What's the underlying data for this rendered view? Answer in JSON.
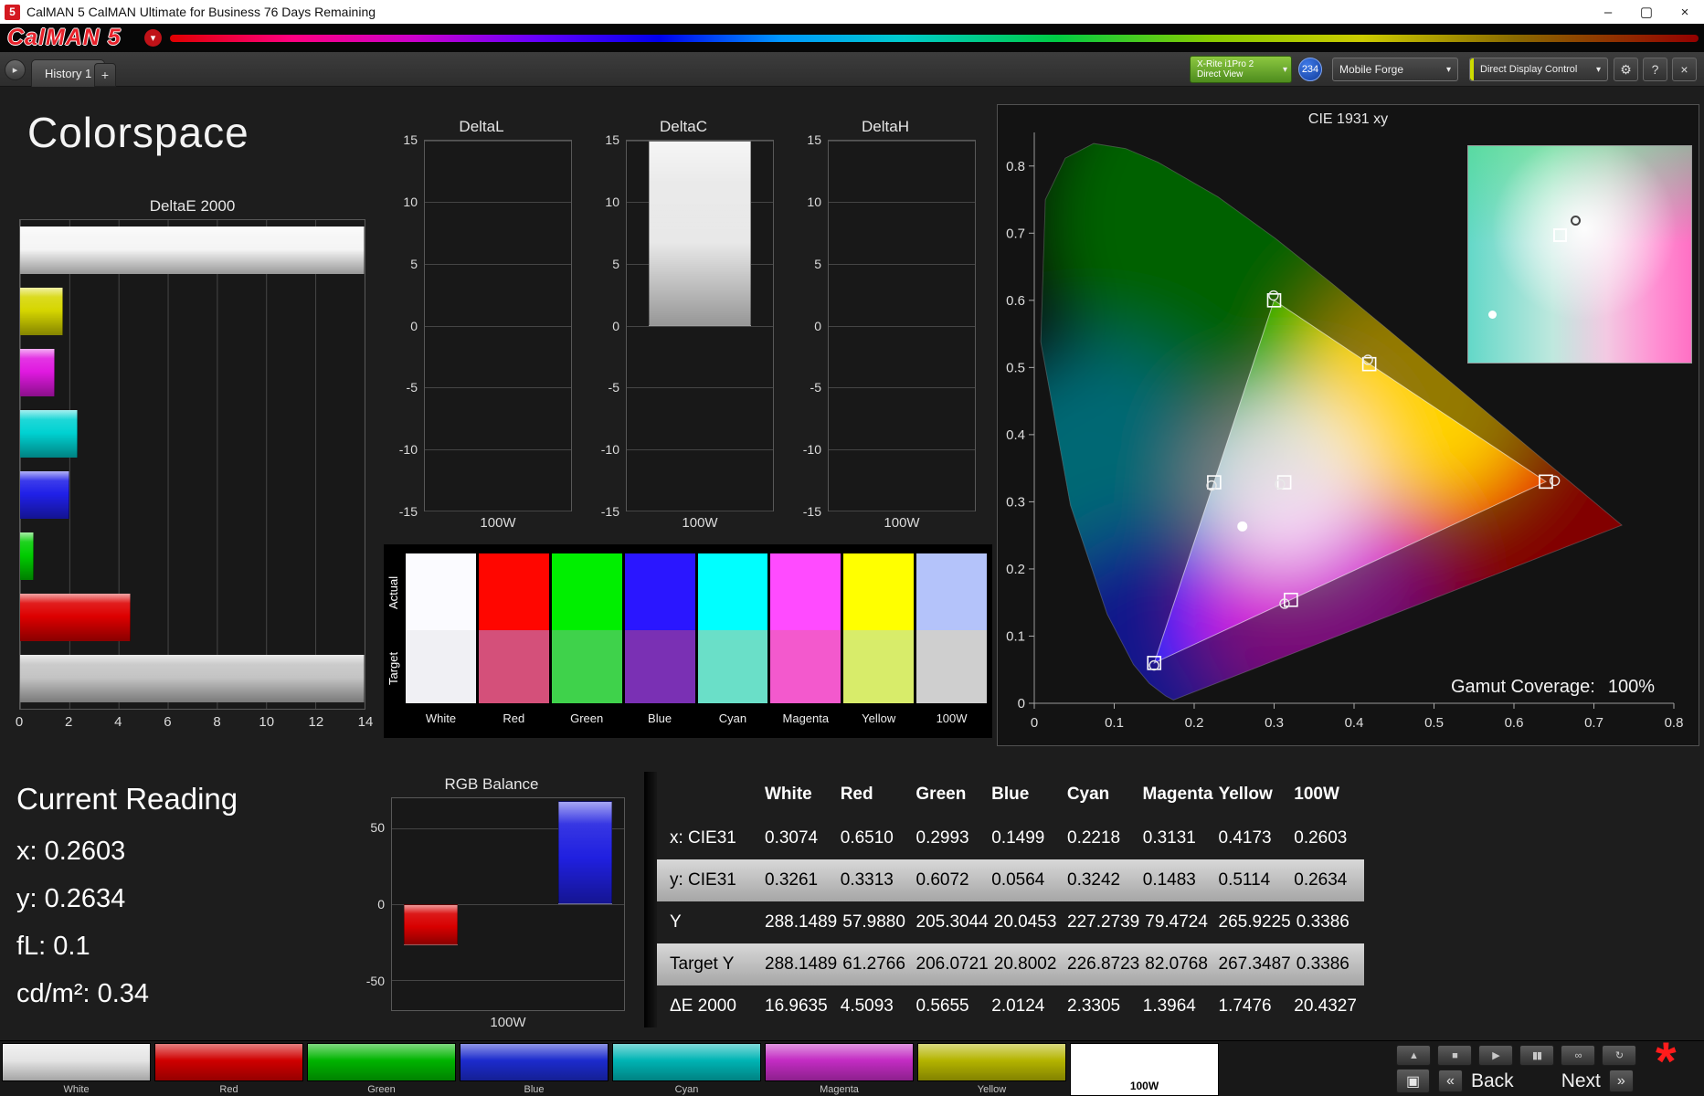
{
  "window": {
    "icon_text": "5",
    "title": "CalMAN 5 CalMAN Ultimate for Business 76 Days Remaining",
    "controls": {
      "minimize": "–",
      "maximize": "▢",
      "close": "×"
    }
  },
  "brand": {
    "logo": "CalMAN 5",
    "chevron": "▾"
  },
  "tabbar": {
    "nav_glyph": "▸",
    "tab_label": "History 1",
    "add_label": "+",
    "meter_line1": "X-Rite i1Pro 2",
    "meter_line2": "Direct View",
    "badge": "234",
    "source_label": "Mobile Forge",
    "control_label": "Direct Display Control",
    "chevron": "▾",
    "gear_glyph": "⚙",
    "help_glyph": "?",
    "close_glyph": "×"
  },
  "page": {
    "title": "Colorspace"
  },
  "current_reading": {
    "title": "Current Reading",
    "lines": [
      "x: 0.2603",
      "y: 0.2634",
      "fL: 0.1",
      "cd/m²: 0.34"
    ]
  },
  "swatches": {
    "row_labels": [
      "Actual",
      "Target"
    ],
    "columns": [
      {
        "label": "White",
        "actual": "#fbfbff",
        "target": "#f0f0f4"
      },
      {
        "label": "Red",
        "actual": "#ff0600",
        "target": "#d4507a"
      },
      {
        "label": "Green",
        "actual": "#00ef00",
        "target": "#3fd24b"
      },
      {
        "label": "Blue",
        "actual": "#2a16ff",
        "target": "#7a30b4"
      },
      {
        "label": "Cyan",
        "actual": "#00ffff",
        "target": "#6adfc8"
      },
      {
        "label": "Magenta",
        "actual": "#ff4bff",
        "target": "#f359cd"
      },
      {
        "label": "Yellow",
        "actual": "#ffff00",
        "target": "#d8ec6a"
      },
      {
        "label": "100W",
        "actual": "#b4c3fa",
        "target": "#cfcfcf"
      }
    ]
  },
  "table": {
    "columns": [
      "White",
      "Red",
      "Green",
      "Blue",
      "Cyan",
      "Magenta",
      "Yellow",
      "100W"
    ],
    "rows": [
      {
        "label": "x: CIE31",
        "striped": false,
        "values": [
          "0.3074",
          "0.6510",
          "0.2993",
          "0.1499",
          "0.2218",
          "0.3131",
          "0.4173",
          "0.2603"
        ]
      },
      {
        "label": "y: CIE31",
        "striped": true,
        "values": [
          "0.3261",
          "0.3313",
          "0.6072",
          "0.0564",
          "0.3242",
          "0.1483",
          "0.5114",
          "0.2634"
        ]
      },
      {
        "label": "Y",
        "striped": false,
        "values": [
          "288.1489",
          "57.9880",
          "205.3044",
          "20.0453",
          "227.2739",
          "79.4724",
          "265.9225",
          "0.3386"
        ]
      },
      {
        "label": "Target Y",
        "striped": true,
        "values": [
          "288.1489",
          "61.2766",
          "206.0721",
          "20.8002",
          "226.8723",
          "82.0768",
          "267.3487",
          "0.3386"
        ]
      },
      {
        "label": "ΔE 2000",
        "striped": false,
        "values": [
          "16.9635",
          "4.5093",
          "0.5655",
          "2.0124",
          "2.3305",
          "1.3964",
          "1.7476",
          "20.4327"
        ]
      }
    ]
  },
  "bottom": {
    "patches": [
      {
        "label": "White",
        "color": "#e4e4e4",
        "selected": false
      },
      {
        "label": "Red",
        "color": "#cf0000",
        "selected": false
      },
      {
        "label": "Green",
        "color": "#00b400",
        "selected": false
      },
      {
        "label": "Blue",
        "color": "#1c2bcd",
        "selected": false
      },
      {
        "label": "Cyan",
        "color": "#00b4b4",
        "selected": false
      },
      {
        "label": "Magenta",
        "color": "#c32cc3",
        "selected": false
      },
      {
        "label": "Yellow",
        "color": "#b4b400",
        "selected": false
      },
      {
        "label": "100W",
        "color": "#ffffff",
        "selected": true
      }
    ],
    "transport": [
      "eject",
      "stop",
      "play",
      "pause",
      "link",
      "refresh"
    ],
    "alert_glyph": "*",
    "screen_glyph": "▣",
    "prev_glyph": "«",
    "back_label": "Back",
    "next_label": "Next",
    "fwd_glyph": "»"
  },
  "chart_data": [
    {
      "id": "deltae2000",
      "type": "bar",
      "orientation": "horizontal",
      "title": "DeltaE 2000",
      "categories": [
        "White",
        "Yellow",
        "Magenta",
        "Cyan",
        "Blue",
        "Green",
        "Red",
        "100W"
      ],
      "values": [
        16.9635,
        1.7476,
        1.3964,
        2.3305,
        2.0124,
        0.5655,
        4.5093,
        20.4327
      ],
      "colors": [
        "#f5f5f5",
        "#d6d600",
        "#e019e0",
        "#00d2d2",
        "#2020e8",
        "#00cc00",
        "#dd0000",
        "#c4c4c4"
      ],
      "xlim": [
        0,
        14
      ],
      "xticks": [
        0,
        2,
        4,
        6,
        8,
        10,
        12,
        14
      ]
    },
    {
      "id": "deltaL",
      "type": "bar",
      "title": "DeltaL",
      "categories": [
        "100W"
      ],
      "values": [
        0
      ],
      "colors": [
        "#e8e8e8"
      ],
      "ylim": [
        -15,
        15
      ],
      "yticks": [
        15,
        10,
        5,
        0,
        -5,
        -10,
        -15
      ],
      "xlabel": "100W"
    },
    {
      "id": "deltaC",
      "type": "bar",
      "title": "DeltaC",
      "categories": [
        "100W"
      ],
      "values": [
        15
      ],
      "colors": [
        "#e8e8e8"
      ],
      "ylim": [
        -15,
        15
      ],
      "yticks": [
        15,
        10,
        5,
        0,
        -5,
        -10,
        -15
      ],
      "xlabel": "100W"
    },
    {
      "id": "deltaH",
      "type": "bar",
      "title": "DeltaH",
      "categories": [
        "100W"
      ],
      "values": [
        0
      ],
      "colors": [
        "#e8e8e8"
      ],
      "ylim": [
        -15,
        15
      ],
      "yticks": [
        15,
        10,
        5,
        0,
        -5,
        -10,
        -15
      ],
      "xlabel": "100W"
    },
    {
      "id": "rgb_balance",
      "type": "bar",
      "title": "RGB Balance",
      "categories": [
        "Red",
        "Green",
        "Blue"
      ],
      "values": [
        -27,
        0,
        68
      ],
      "colors": [
        "#d80000",
        "#00b400",
        "#2020e0"
      ],
      "ylim": [
        -70,
        70
      ],
      "yticks": [
        50,
        0,
        -50
      ],
      "xlabel": "100W"
    },
    {
      "id": "cie1931",
      "type": "scatter",
      "title": "CIE 1931 xy",
      "xlim": [
        0,
        0.8
      ],
      "ylim": [
        0,
        0.85
      ],
      "xticks": [
        0,
        0.1,
        0.2,
        0.3,
        0.4,
        0.5,
        0.6,
        0.7,
        0.8
      ],
      "yticks": [
        0,
        0.1,
        0.2,
        0.3,
        0.4,
        0.5,
        0.6,
        0.7,
        0.8
      ],
      "gamut_triangle": {
        "red": [
          0.64,
          0.33
        ],
        "green": [
          0.3,
          0.6
        ],
        "blue": [
          0.15,
          0.06
        ]
      },
      "targets": [
        {
          "name": "white",
          "xy": [
            0.3127,
            0.329
          ]
        },
        {
          "name": "red",
          "xy": [
            0.64,
            0.33
          ]
        },
        {
          "name": "green",
          "xy": [
            0.3,
            0.6
          ]
        },
        {
          "name": "blue",
          "xy": [
            0.15,
            0.06
          ]
        },
        {
          "name": "cyan",
          "xy": [
            0.225,
            0.329
          ]
        },
        {
          "name": "magenta",
          "xy": [
            0.321,
            0.154
          ]
        },
        {
          "name": "yellow",
          "xy": [
            0.419,
            0.505
          ]
        }
      ],
      "measured": [
        {
          "name": "white",
          "xy": [
            0.3074,
            0.3261
          ]
        },
        {
          "name": "red",
          "xy": [
            0.651,
            0.3313
          ]
        },
        {
          "name": "green",
          "xy": [
            0.2993,
            0.6072
          ]
        },
        {
          "name": "blue",
          "xy": [
            0.1499,
            0.0564
          ]
        },
        {
          "name": "cyan",
          "xy": [
            0.2218,
            0.3242
          ]
        },
        {
          "name": "magenta",
          "xy": [
            0.3131,
            0.1483
          ]
        },
        {
          "name": "yellow",
          "xy": [
            0.4173,
            0.5114
          ]
        }
      ],
      "current": [
        0.2603,
        0.2634
      ],
      "coverage_label": "Gamut Coverage:",
      "coverage_value": "100%"
    }
  ]
}
